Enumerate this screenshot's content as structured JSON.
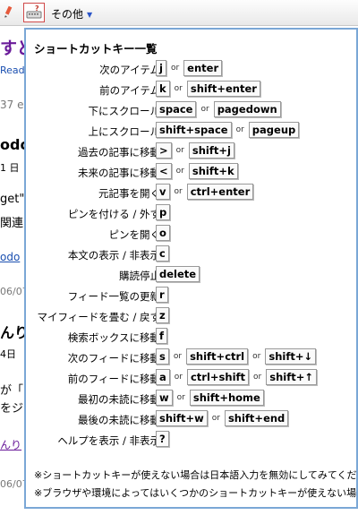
{
  "toolbar": {
    "menu_label": "その他",
    "first_icon": "pencil-icon",
    "keyboard_icon": "keyboard-help-icon"
  },
  "background_fragments": [
    {
      "text": "すど",
      "color": "#6a1b9a"
    },
    {
      "text": "Read",
      "color": "#1a4fb0"
    },
    {
      "text": "37 e",
      "color": "#777777"
    },
    {
      "text": "odo",
      "color": "#000000"
    },
    {
      "text": "1 日",
      "color": "#000000"
    },
    {
      "text": "get\"",
      "color": "#000000"
    },
    {
      "text": "関連",
      "color": "#000000"
    },
    {
      "text": "odo",
      "color": "#1a4fb0"
    },
    {
      "text": "06/07",
      "color": "#777777"
    },
    {
      "text": "んり",
      "color": "#000000"
    },
    {
      "text": "4日",
      "color": "#000000"
    },
    {
      "text": "が「",
      "color": "#000000"
    },
    {
      "text": "をジ",
      "color": "#000000"
    },
    {
      "text": "んり",
      "color": "#6a1b9a"
    },
    {
      "text": "06/07",
      "color": "#777777"
    }
  ],
  "panel": {
    "title": "ショートカットキー一覧",
    "or_label": "or",
    "shortcuts": [
      {
        "label": "次のアイテム",
        "keys": [
          "j",
          "enter"
        ]
      },
      {
        "label": "前のアイテム",
        "keys": [
          "k",
          "shift+enter"
        ]
      },
      {
        "label": "下にスクロール",
        "keys": [
          "space",
          "pagedown"
        ]
      },
      {
        "label": "上にスクロール",
        "keys": [
          "shift+space",
          "pageup"
        ]
      },
      {
        "label": "過去の記事に移動",
        "keys": [
          ">",
          "shift+j"
        ]
      },
      {
        "label": "未来の記事に移動",
        "keys": [
          "<",
          "shift+k"
        ]
      },
      {
        "label": "元記事を開く",
        "keys": [
          "v",
          "ctrl+enter"
        ]
      },
      {
        "label": "ピンを付ける / 外す",
        "keys": [
          "p"
        ]
      },
      {
        "label": "ピンを開く",
        "keys": [
          "o"
        ]
      },
      {
        "label": "本文の表示 / 非表示",
        "keys": [
          "c"
        ]
      },
      {
        "label": "購読停止",
        "keys": [
          "delete"
        ]
      },
      {
        "label": "フィード一覧の更新",
        "keys": [
          "r"
        ]
      },
      {
        "label": "マイフィードを畳む / 戻す",
        "keys": [
          "z"
        ]
      },
      {
        "label": "検索ボックスに移動",
        "keys": [
          "f"
        ]
      },
      {
        "label": "次のフィードに移動",
        "keys": [
          "s",
          "shift+ctrl",
          "shift+↓"
        ]
      },
      {
        "label": "前のフィードに移動",
        "keys": [
          "a",
          "ctrl+shift",
          "shift+↑"
        ]
      },
      {
        "label": "最初の未読に移動",
        "keys": [
          "w",
          "shift+home"
        ]
      },
      {
        "label": "最後の未読に移動",
        "keys": [
          "shift+w",
          "shift+end"
        ]
      },
      {
        "label": "ヘルプを表示 / 非表示",
        "keys": [
          "?"
        ]
      }
    ],
    "notes": [
      "※ショートカットキーが使えない場合は日本語入力を無効にしてみてくだ",
      "※ブラウザや環境によってはいくつかのショートカットキーが使えない場合"
    ]
  }
}
